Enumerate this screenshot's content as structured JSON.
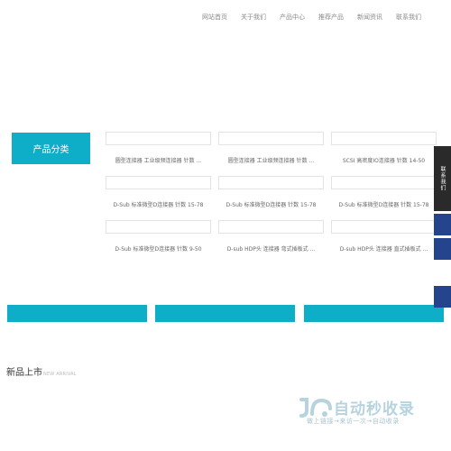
{
  "nav": {
    "items": [
      "网站首页",
      "关于我们",
      "产品中心",
      "推荐产品",
      "新闻资讯",
      "联系我们"
    ]
  },
  "category": {
    "label": "产品分类"
  },
  "products": [
    "圆型连接器 工业级频连接器 针数 ...",
    "圆型连接器 工业级频连接器 针数 ...",
    "SCSI 高密度IO连接器 针数 14-50",
    "D-Sub 标准微型D连接器 针数 15-78",
    "D-Sub 标准微型D连接器 针数 15-78",
    "D-Sub 标准微型D连接器 针数 15-78",
    "D-Sub 标准微型D连接器 针数 9-50",
    "D-sub HDP头 连接器 弯式插板式 ...",
    "D-sub HDP头 连接器 直式插板式 ..."
  ],
  "float": {
    "contact_label": "联系我们"
  },
  "new_arrivals": {
    "title": "新品上市",
    "subtitle": "NEW ARRIVAL"
  },
  "watermark": {
    "brand": "自动秒收录",
    "slogan": "做上链接→来访一次→自动收录"
  },
  "colors": {
    "accent": "#0eaec9",
    "float_blue": "#24448e",
    "float_dark": "#2a2a2a"
  }
}
